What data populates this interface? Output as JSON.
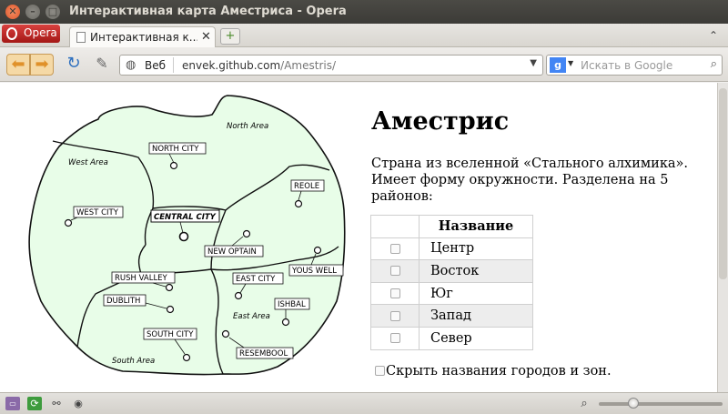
{
  "window": {
    "title": "Интерактивная карта Аместриса - Opera",
    "close_glyph": "✕",
    "min_glyph": "–",
    "max_glyph": "□"
  },
  "tabs": {
    "menu_label": "Opera",
    "active_tab_label": "Интерактивная к...",
    "close_glyph": "✕",
    "new_tab_glyph": "+",
    "tab_menu_glyph": "⌃"
  },
  "navbar": {
    "back_glyph": "⬅",
    "forward_glyph": "➡",
    "reload_glyph": "↻",
    "edit_glyph": "✎",
    "address_type": "Веб",
    "url_host": "envek.github.com",
    "url_path": "/Amestris/",
    "search_engine": "g",
    "search_placeholder": "Искать в Google"
  },
  "map": {
    "areas": [
      "North Area",
      "West Area",
      "East Area",
      "South Area"
    ],
    "cities": [
      {
        "name": "NORTH CITY"
      },
      {
        "name": "WEST CITY"
      },
      {
        "name": "CENTRAL CITY"
      },
      {
        "name": "NEW OPTAIN"
      },
      {
        "name": "REOLE"
      },
      {
        "name": "YOUS WELL"
      },
      {
        "name": "RUSH VALLEY"
      },
      {
        "name": "DUBLITH"
      },
      {
        "name": "EAST CITY"
      },
      {
        "name": "ISHBAL"
      },
      {
        "name": "SOUTH CITY"
      },
      {
        "name": "RESEMBOOL"
      }
    ]
  },
  "content": {
    "title": "Аместрис",
    "description": "Страна из вселенной «Стального алхимика». Имеет форму окружности. Разделена на 5 районов:",
    "table_header": "Название",
    "districts": [
      "Центр",
      "Восток",
      "Юг",
      "Запад",
      "Север"
    ],
    "hide_names_label": "Скрыть названия городов и зон."
  },
  "statusbar": {
    "zoom_level_fraction": 0.28
  },
  "colors": {
    "map_fill": "#e8fde8",
    "titlebar": "#3c3b37",
    "opera_red": "#c1201e"
  }
}
